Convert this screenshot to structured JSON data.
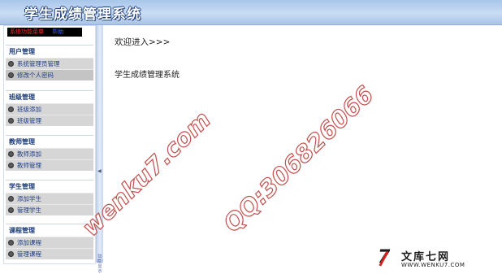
{
  "app": {
    "title": "学生成绩管理系统"
  },
  "menu": {
    "banner_left": "系统功能菜单",
    "banner_right": "帮助"
  },
  "sidebar": {
    "groups": [
      {
        "title": "用户管理",
        "items": [
          {
            "label": "系统管理员管理"
          },
          {
            "label": "修改个人密码",
            "selected": true
          }
        ]
      },
      {
        "title": "班级管理",
        "items": [
          {
            "label": "班级添加"
          },
          {
            "label": "班级管理"
          }
        ]
      },
      {
        "title": "教师管理",
        "items": [
          {
            "label": "教师添加"
          },
          {
            "label": "教师管理"
          }
        ]
      },
      {
        "title": "学生管理",
        "items": [
          {
            "label": "添加学生"
          },
          {
            "label": "管理学生"
          }
        ]
      },
      {
        "title": "课程管理",
        "items": [
          {
            "label": "添加课程"
          },
          {
            "label": "管理课程"
          }
        ]
      }
    ],
    "splitter_text": "隐藏/显示"
  },
  "main": {
    "welcome": "欢迎进入>>>",
    "system_name": "学生成绩管理系统"
  },
  "watermark": {
    "domain": "wenku7.com",
    "qq": "QQ:306826066"
  },
  "logo": {
    "cn": "文库七网",
    "url": "WWW.WENKU7.COM"
  },
  "colors": {
    "header_bg": "#b8d0ef",
    "link": "#1e3e86",
    "watermark": "#c0504d",
    "item_bg": "#d6d6d6"
  }
}
